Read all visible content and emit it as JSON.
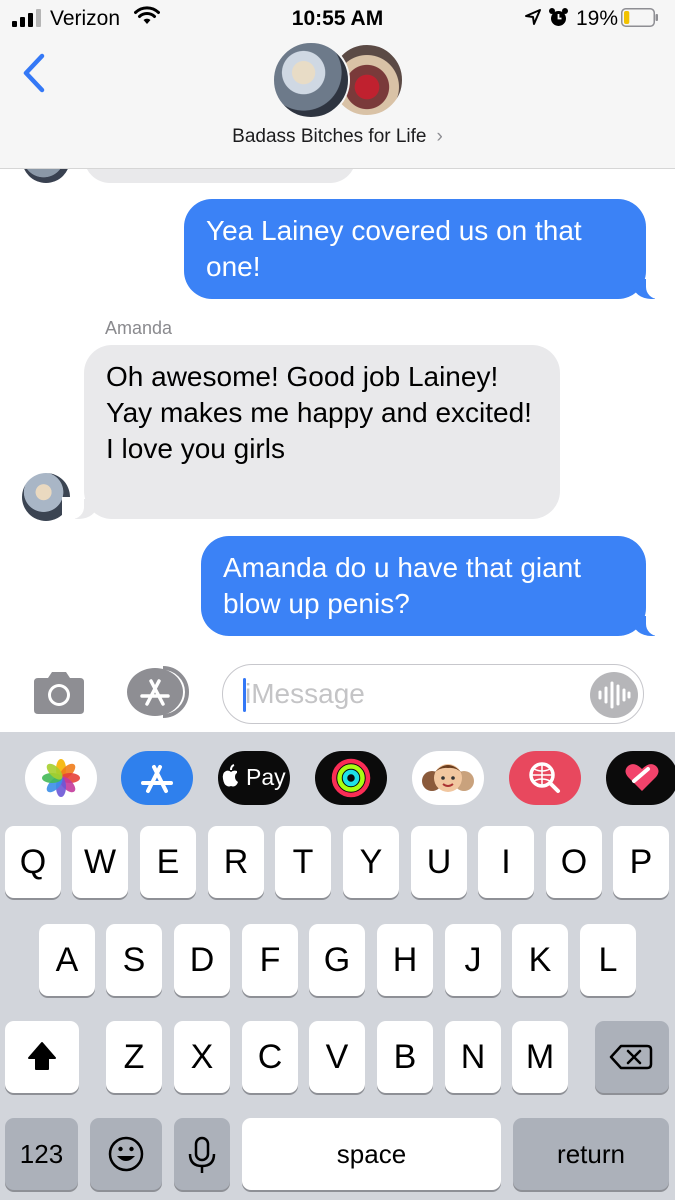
{
  "status_bar": {
    "carrier": "Verizon",
    "time": "10:55 AM",
    "battery_percent": "19%",
    "battery_level": 0.19,
    "icons": [
      "signal-icon",
      "wifi-icon",
      "location-arrow-icon",
      "alarm-icon",
      "battery-icon"
    ]
  },
  "header": {
    "back_icon": "chevron-left-icon",
    "group_name": "Badass Bitches for Life",
    "group_chevron": "›"
  },
  "messages": [
    {
      "direction": "outgoing",
      "text": "Yea Lainey covered us on that one!"
    },
    {
      "direction": "incoming",
      "sender": "Amanda",
      "lines": [
        "Oh awesome! Good job Lainey!",
        "Yay makes me happy and excited!",
        "I love you girls"
      ]
    },
    {
      "direction": "outgoing",
      "text": "Amanda do u have that giant blow up penis?"
    }
  ],
  "composer": {
    "placeholder": "iMessage",
    "value": "",
    "icons": [
      "camera-icon",
      "app-store-icon",
      "audio-waveform-icon"
    ]
  },
  "app_drawer": {
    "apps": [
      "photos-icon",
      "app-store-icon",
      "apple-pay-icon",
      "activity-rings-icon",
      "memoji-icon",
      "web-search-icon",
      "digital-touch-icon"
    ],
    "apple_pay_label": "Pay"
  },
  "keyboard": {
    "row1": [
      "Q",
      "W",
      "E",
      "R",
      "T",
      "Y",
      "U",
      "I",
      "O",
      "P"
    ],
    "row2": [
      "A",
      "S",
      "D",
      "F",
      "G",
      "H",
      "J",
      "K",
      "L"
    ],
    "row3": [
      "Z",
      "X",
      "C",
      "V",
      "B",
      "N",
      "M"
    ],
    "numbers_label": "123",
    "space_label": "space",
    "return_label": "return",
    "icons": [
      "shift-icon",
      "delete-icon",
      "emoji-icon",
      "microphone-icon"
    ]
  },
  "colors": {
    "outgoing_bubble": "#3b82f6",
    "incoming_bubble": "#e9e9eb",
    "ios_blue": "#3478f6",
    "keyboard_bg": "#d2d5db"
  }
}
